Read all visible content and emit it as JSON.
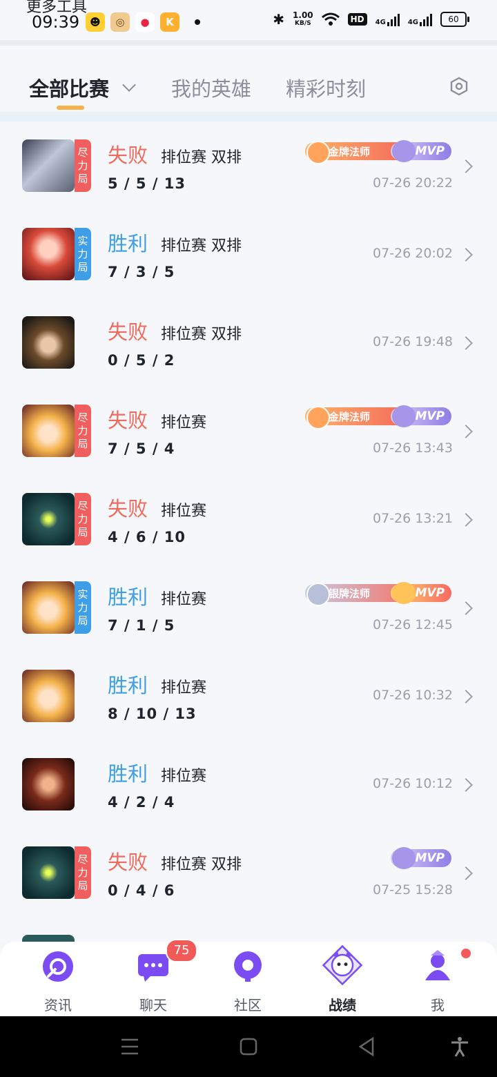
{
  "status_bar": {
    "title_cut": "更多工具",
    "time": "09:39",
    "net_speed_value": "1.00",
    "net_speed_unit": "KB/S",
    "hd_label": "HD",
    "signal1_label": "4G",
    "signal2_label": "4G",
    "battery": "60"
  },
  "tabs": [
    {
      "label": "全部比赛"
    },
    {
      "label": "我的英雄"
    },
    {
      "label": "精彩时刻"
    }
  ],
  "matches": [
    {
      "badge": [
        "尽",
        "力",
        "局"
      ],
      "badge_color": "red",
      "result": "失败",
      "result_type": "lose",
      "mode": "排位赛 双排",
      "kda": "5 / 5 / 13",
      "time": "07-26 20:22",
      "tag": "金牌法师",
      "tag_type": "gold",
      "mvp": "MVP",
      "mvp_type": "purple"
    },
    {
      "badge": [
        "实",
        "力",
        "局"
      ],
      "badge_color": "blue",
      "result": "胜利",
      "result_type": "win",
      "mode": "排位赛 双排",
      "kda": "7 / 3 / 5",
      "time": "07-26 20:02"
    },
    {
      "result": "失败",
      "result_type": "lose",
      "mode": "排位赛 双排",
      "kda": "0 / 5 / 2",
      "time": "07-26 19:48"
    },
    {
      "badge": [
        "尽",
        "力",
        "局"
      ],
      "badge_color": "red",
      "result": "失败",
      "result_type": "lose",
      "mode": "排位赛",
      "kda": "7 / 5 / 4",
      "time": "07-26 13:43",
      "tag": "金牌法师",
      "tag_type": "gold",
      "mvp": "MVP",
      "mvp_type": "purple"
    },
    {
      "badge": [
        "尽",
        "力",
        "局"
      ],
      "badge_color": "red",
      "result": "失败",
      "result_type": "lose",
      "mode": "排位赛",
      "kda": "4 / 6 / 10",
      "time": "07-26 13:21"
    },
    {
      "badge": [
        "实",
        "力",
        "局"
      ],
      "badge_color": "blue",
      "result": "胜利",
      "result_type": "win",
      "mode": "排位赛",
      "kda": "7 / 1 / 5",
      "time": "07-26 12:45",
      "tag": "银牌法师",
      "tag_type": "silver",
      "mvp": "MVP",
      "mvp_type": "orange"
    },
    {
      "result": "胜利",
      "result_type": "win",
      "mode": "排位赛",
      "kda": "8 / 10 / 13",
      "time": "07-26 10:32"
    },
    {
      "result": "胜利",
      "result_type": "win",
      "mode": "排位赛",
      "kda": "4 / 2 / 4",
      "time": "07-26 10:12"
    },
    {
      "badge": [
        "尽",
        "力",
        "局"
      ],
      "badge_color": "red",
      "result": "失败",
      "result_type": "lose",
      "mode": "排位赛 双排",
      "kda": "0 / 4 / 6",
      "time": "07-25 15:28",
      "mvp": "MVP",
      "mvp_type": "purple"
    }
  ],
  "bottom_nav": [
    {
      "label": "资讯",
      "icon": "news-icon"
    },
    {
      "label": "聊天",
      "icon": "chat-icon",
      "badge": "75"
    },
    {
      "label": "社区",
      "icon": "community-icon"
    },
    {
      "label": "战绩",
      "icon": "record-icon",
      "active": true
    },
    {
      "label": "我",
      "icon": "profile-icon",
      "dot": true
    }
  ],
  "colors": {
    "lose": "#f16a5e",
    "win": "#3d9fe0",
    "accent": "#f5b24a",
    "nav_purple": "#7b4cf2"
  }
}
